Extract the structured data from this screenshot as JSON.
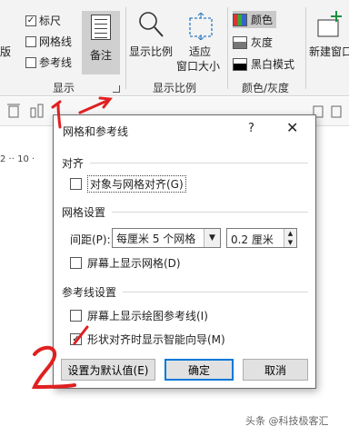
{
  "ribbon": {
    "edge_text": "版",
    "show_checks": [
      {
        "label": "标尺",
        "checked": true
      },
      {
        "label": "网格线",
        "checked": false
      },
      {
        "label": "参考线",
        "checked": false
      }
    ],
    "notes_label": "备注",
    "zoom_label": "显示比例",
    "fit_label_1": "适应",
    "fit_label_2": "窗口大小",
    "color_options": [
      {
        "label": "颜色",
        "selected": true
      },
      {
        "label": "灰度",
        "selected": false
      },
      {
        "label": "黑白模式",
        "selected": false
      }
    ],
    "new_window_label": "新建窗口",
    "group_show": "显示",
    "group_zoom": "显示比例",
    "group_color": "颜色/灰度"
  },
  "ruler": {
    "text": "2 ·· 10 ·"
  },
  "dialog": {
    "title": "网格和参考线",
    "help": "?",
    "close": "✕",
    "section_align": "对齐",
    "snap_to_grid": {
      "label": "对象与网格对齐(G)",
      "checked": false
    },
    "section_grid": "网格设置",
    "spacing_label": "间距(P):",
    "spacing_value": "每厘米 5 个网格",
    "spacing_cm": "0.2 厘米",
    "show_grid": {
      "label": "屏幕上显示网格(D)",
      "checked": false
    },
    "section_guides": "参考线设置",
    "show_guides": {
      "label": "屏幕上显示绘图参考线(I)",
      "checked": false
    },
    "smart_guides": {
      "label": "形状对齐时显示智能向导(M)",
      "checked": true
    },
    "btn_default": "设置为默认值(E)",
    "btn_ok": "确定",
    "btn_cancel": "取消"
  },
  "annotations": {
    "mark_1": "1",
    "mark_2": "2"
  },
  "watermark": "头条 @科技极客汇",
  "colors": {
    "annotation": "#e02020",
    "accent": "#0078d7"
  }
}
